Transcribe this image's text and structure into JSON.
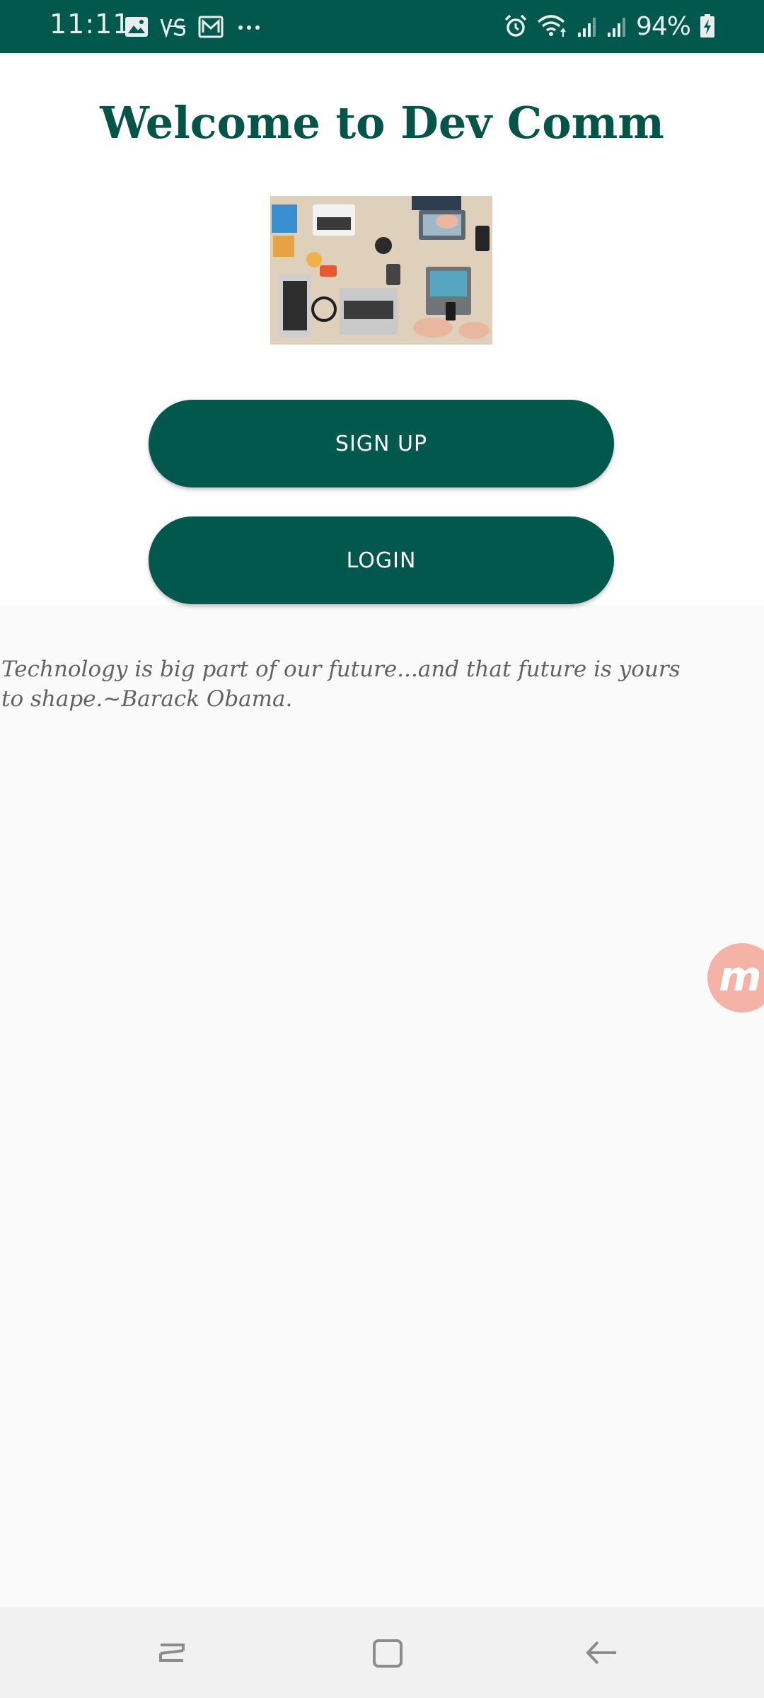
{
  "status_bar": {
    "time": "11:11",
    "battery": "94%",
    "left_icons": [
      "image-icon",
      "vs-app-icon",
      "mail-app-icon",
      "more-dots-icon"
    ],
    "right_icons": [
      "alarm-icon",
      "wifi-icon",
      "signal-icon",
      "signal-icon-2",
      "battery-charging-icon"
    ],
    "background_color": "#02584c"
  },
  "header": {
    "title": "Welcome to Dev Comm"
  },
  "hero": {
    "icon": "workspace-photo"
  },
  "actions": {
    "signup_label": "SIGN UP",
    "login_label": "LOGIN",
    "button_color": "#02584c"
  },
  "quote": {
    "text": "Technology is big part of our future...and that future is yours to shape.~Barack Obama."
  },
  "floating_badge": {
    "letter": "m",
    "color": "#f4b3a6"
  },
  "nav_bar": {
    "buttons": [
      "recents-icon",
      "home-icon",
      "back-icon"
    ]
  }
}
